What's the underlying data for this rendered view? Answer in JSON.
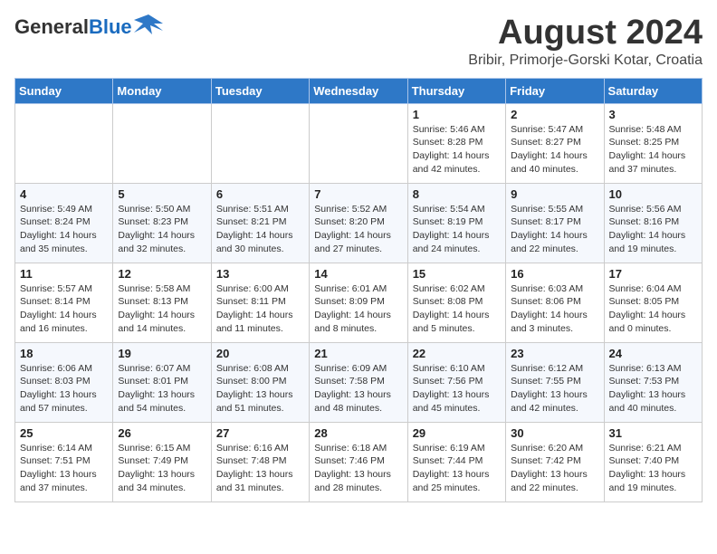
{
  "header": {
    "logo_general": "General",
    "logo_blue": "Blue",
    "month_title": "August 2024",
    "location": "Bribir, Primorje-Gorski Kotar, Croatia"
  },
  "days_of_week": [
    "Sunday",
    "Monday",
    "Tuesday",
    "Wednesday",
    "Thursday",
    "Friday",
    "Saturday"
  ],
  "weeks": [
    [
      {
        "day": "",
        "info": ""
      },
      {
        "day": "",
        "info": ""
      },
      {
        "day": "",
        "info": ""
      },
      {
        "day": "",
        "info": ""
      },
      {
        "day": "1",
        "info": "Sunrise: 5:46 AM\nSunset: 8:28 PM\nDaylight: 14 hours and 42 minutes."
      },
      {
        "day": "2",
        "info": "Sunrise: 5:47 AM\nSunset: 8:27 PM\nDaylight: 14 hours and 40 minutes."
      },
      {
        "day": "3",
        "info": "Sunrise: 5:48 AM\nSunset: 8:25 PM\nDaylight: 14 hours and 37 minutes."
      }
    ],
    [
      {
        "day": "4",
        "info": "Sunrise: 5:49 AM\nSunset: 8:24 PM\nDaylight: 14 hours and 35 minutes."
      },
      {
        "day": "5",
        "info": "Sunrise: 5:50 AM\nSunset: 8:23 PM\nDaylight: 14 hours and 32 minutes."
      },
      {
        "day": "6",
        "info": "Sunrise: 5:51 AM\nSunset: 8:21 PM\nDaylight: 14 hours and 30 minutes."
      },
      {
        "day": "7",
        "info": "Sunrise: 5:52 AM\nSunset: 8:20 PM\nDaylight: 14 hours and 27 minutes."
      },
      {
        "day": "8",
        "info": "Sunrise: 5:54 AM\nSunset: 8:19 PM\nDaylight: 14 hours and 24 minutes."
      },
      {
        "day": "9",
        "info": "Sunrise: 5:55 AM\nSunset: 8:17 PM\nDaylight: 14 hours and 22 minutes."
      },
      {
        "day": "10",
        "info": "Sunrise: 5:56 AM\nSunset: 8:16 PM\nDaylight: 14 hours and 19 minutes."
      }
    ],
    [
      {
        "day": "11",
        "info": "Sunrise: 5:57 AM\nSunset: 8:14 PM\nDaylight: 14 hours and 16 minutes."
      },
      {
        "day": "12",
        "info": "Sunrise: 5:58 AM\nSunset: 8:13 PM\nDaylight: 14 hours and 14 minutes."
      },
      {
        "day": "13",
        "info": "Sunrise: 6:00 AM\nSunset: 8:11 PM\nDaylight: 14 hours and 11 minutes."
      },
      {
        "day": "14",
        "info": "Sunrise: 6:01 AM\nSunset: 8:09 PM\nDaylight: 14 hours and 8 minutes."
      },
      {
        "day": "15",
        "info": "Sunrise: 6:02 AM\nSunset: 8:08 PM\nDaylight: 14 hours and 5 minutes."
      },
      {
        "day": "16",
        "info": "Sunrise: 6:03 AM\nSunset: 8:06 PM\nDaylight: 14 hours and 3 minutes."
      },
      {
        "day": "17",
        "info": "Sunrise: 6:04 AM\nSunset: 8:05 PM\nDaylight: 14 hours and 0 minutes."
      }
    ],
    [
      {
        "day": "18",
        "info": "Sunrise: 6:06 AM\nSunset: 8:03 PM\nDaylight: 13 hours and 57 minutes."
      },
      {
        "day": "19",
        "info": "Sunrise: 6:07 AM\nSunset: 8:01 PM\nDaylight: 13 hours and 54 minutes."
      },
      {
        "day": "20",
        "info": "Sunrise: 6:08 AM\nSunset: 8:00 PM\nDaylight: 13 hours and 51 minutes."
      },
      {
        "day": "21",
        "info": "Sunrise: 6:09 AM\nSunset: 7:58 PM\nDaylight: 13 hours and 48 minutes."
      },
      {
        "day": "22",
        "info": "Sunrise: 6:10 AM\nSunset: 7:56 PM\nDaylight: 13 hours and 45 minutes."
      },
      {
        "day": "23",
        "info": "Sunrise: 6:12 AM\nSunset: 7:55 PM\nDaylight: 13 hours and 42 minutes."
      },
      {
        "day": "24",
        "info": "Sunrise: 6:13 AM\nSunset: 7:53 PM\nDaylight: 13 hours and 40 minutes."
      }
    ],
    [
      {
        "day": "25",
        "info": "Sunrise: 6:14 AM\nSunset: 7:51 PM\nDaylight: 13 hours and 37 minutes."
      },
      {
        "day": "26",
        "info": "Sunrise: 6:15 AM\nSunset: 7:49 PM\nDaylight: 13 hours and 34 minutes."
      },
      {
        "day": "27",
        "info": "Sunrise: 6:16 AM\nSunset: 7:48 PM\nDaylight: 13 hours and 31 minutes."
      },
      {
        "day": "28",
        "info": "Sunrise: 6:18 AM\nSunset: 7:46 PM\nDaylight: 13 hours and 28 minutes."
      },
      {
        "day": "29",
        "info": "Sunrise: 6:19 AM\nSunset: 7:44 PM\nDaylight: 13 hours and 25 minutes."
      },
      {
        "day": "30",
        "info": "Sunrise: 6:20 AM\nSunset: 7:42 PM\nDaylight: 13 hours and 22 minutes."
      },
      {
        "day": "31",
        "info": "Sunrise: 6:21 AM\nSunset: 7:40 PM\nDaylight: 13 hours and 19 minutes."
      }
    ]
  ]
}
